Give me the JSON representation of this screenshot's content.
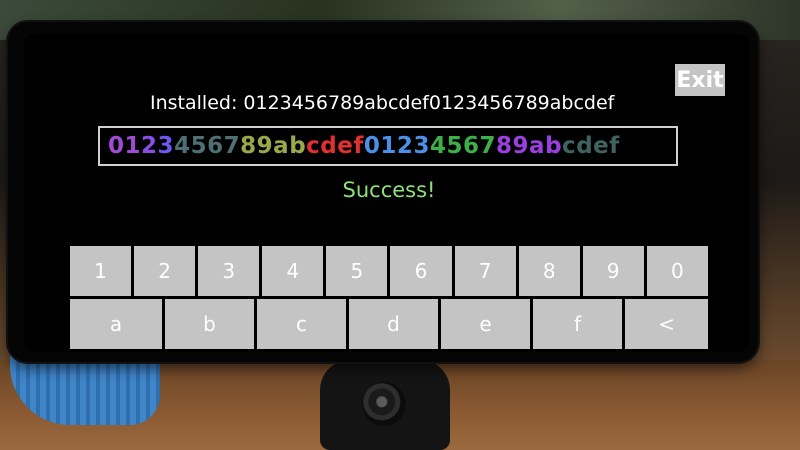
{
  "header": {
    "exit_label": "Exit"
  },
  "installed": {
    "text": "Installed: 0123456789abcdef0123456789abcdef"
  },
  "entry": {
    "chars": [
      {
        "c": "0",
        "color": "#a24ad6"
      },
      {
        "c": "1",
        "color": "#a24ad6"
      },
      {
        "c": "2",
        "color": "#8a4ee8"
      },
      {
        "c": "3",
        "color": "#6e58f0"
      },
      {
        "c": "4",
        "color": "#4e6f73"
      },
      {
        "c": "5",
        "color": "#4e6f73"
      },
      {
        "c": "6",
        "color": "#4e6f73"
      },
      {
        "c": "7",
        "color": "#4e6f73"
      },
      {
        "c": "8",
        "color": "#9aa84a"
      },
      {
        "c": "9",
        "color": "#9aa84a"
      },
      {
        "c": "a",
        "color": "#9aa84a"
      },
      {
        "c": "b",
        "color": "#9aa84a"
      },
      {
        "c": "c",
        "color": "#e23030"
      },
      {
        "c": "d",
        "color": "#e23030"
      },
      {
        "c": "e",
        "color": "#e23030"
      },
      {
        "c": "f",
        "color": "#e23030"
      },
      {
        "c": "0",
        "color": "#4b8fe8"
      },
      {
        "c": "1",
        "color": "#4b8fe8"
      },
      {
        "c": "2",
        "color": "#4b8fe8"
      },
      {
        "c": "3",
        "color": "#4b8fe8"
      },
      {
        "c": "4",
        "color": "#3eb04a"
      },
      {
        "c": "5",
        "color": "#3eb04a"
      },
      {
        "c": "6",
        "color": "#3eb04a"
      },
      {
        "c": "7",
        "color": "#3eb04a"
      },
      {
        "c": "8",
        "color": "#9b3fe0"
      },
      {
        "c": "9",
        "color": "#9b3fe0"
      },
      {
        "c": "a",
        "color": "#9b3fe0"
      },
      {
        "c": "b",
        "color": "#9b3fe0"
      },
      {
        "c": "c",
        "color": "#3f6460"
      },
      {
        "c": "d",
        "color": "#3f6460"
      },
      {
        "c": "e",
        "color": "#3f6460"
      },
      {
        "c": "f",
        "color": "#3f6460"
      }
    ]
  },
  "status": {
    "text": "Success!",
    "color": "#8fe07a"
  },
  "keyboard": {
    "digit_row": [
      "1",
      "2",
      "3",
      "4",
      "5",
      "6",
      "7",
      "8",
      "9",
      "0"
    ],
    "letter_row": [
      "a",
      "b",
      "c",
      "d",
      "e",
      "f",
      "<"
    ]
  }
}
